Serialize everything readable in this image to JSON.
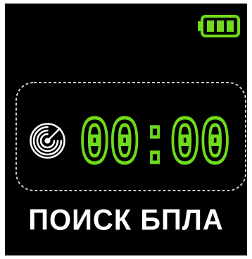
{
  "battery": {
    "icon": "battery-full-icon",
    "level": 1.0,
    "color": "#6FDB1B"
  },
  "timer": {
    "value": "00:00",
    "color": "#6FDB1B"
  },
  "status": {
    "icon": "radar-icon",
    "text": "ПОИСК БПЛА"
  },
  "colors": {
    "background": "#000000",
    "accent": "#6FDB1B",
    "text": "#FFFFFF",
    "frame": "#CCCCCC"
  }
}
